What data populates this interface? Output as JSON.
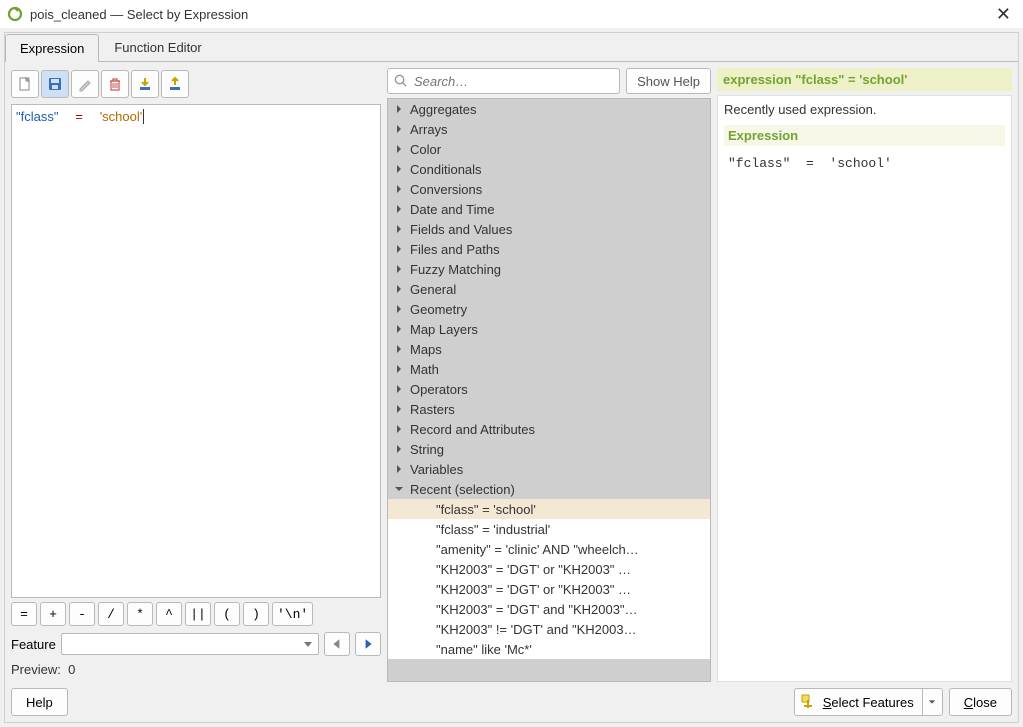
{
  "window": {
    "title": "pois_cleaned — Select by Expression"
  },
  "tabs": {
    "expression": "Expression",
    "func_editor": "Function Editor"
  },
  "toolbar_icons": {
    "new": "new-file-icon",
    "save": "save-icon",
    "edit": "edit-icon",
    "delete": "trash-icon",
    "import": "import-icon",
    "export": "export-icon"
  },
  "expression": {
    "tokens": {
      "field": "\"fclass\"",
      "op": "=",
      "str": "'school'"
    }
  },
  "operators": [
    "=",
    "+",
    "-",
    "/",
    "*",
    "^",
    "||",
    "(",
    ")",
    "'\\n'"
  ],
  "feature": {
    "label": "Feature",
    "value": ""
  },
  "preview": {
    "label": "Preview:",
    "value": "0"
  },
  "search": {
    "placeholder": "Search…"
  },
  "buttons": {
    "show_help": "Show Help",
    "help": "Help",
    "select_features": "Select Features",
    "close": "Close"
  },
  "function_groups": [
    "Aggregates",
    "Arrays",
    "Color",
    "Conditionals",
    "Conversions",
    "Date and Time",
    "Fields and Values",
    "Files and Paths",
    "Fuzzy Matching",
    "General",
    "Geometry",
    "Map Layers",
    "Maps",
    "Math",
    "Operators",
    "Rasters",
    "Record and Attributes",
    "String",
    "Variables"
  ],
  "recent": {
    "label": "Recent (selection)",
    "items": [
      "\"fclass\"  =  'school'",
      "\"fclass\"  =  'industrial'",
      "\"amenity\" = 'clinic' AND \"wheelch…",
      "\"KH2003\" =  'DGT' or  \"KH2003\" …",
      "\"KH2003\" =  'DGT' or  \"KH2003\" …",
      "\"KH2003\" =  'DGT' and  \"KH2003\"…",
      "\"KH2003\" !=  'DGT' and  \"KH2003…",
      "\"name\"  like 'Mc*'"
    ]
  },
  "help_panel": {
    "title": "expression \"fclass\" = 'school'",
    "desc": "Recently used expression.",
    "expr_hdr": "Expression",
    "expr_code": "\"fclass\"  =  'school'"
  }
}
